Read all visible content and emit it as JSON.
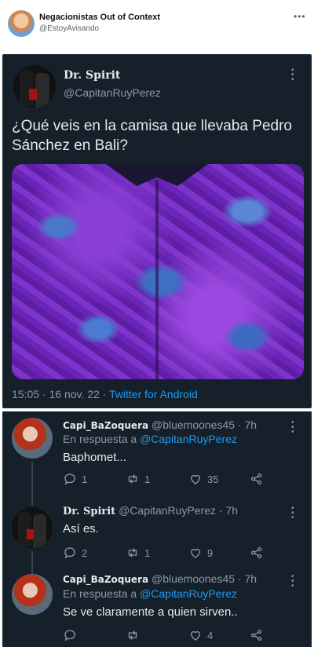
{
  "outer": {
    "name": "Negacionistas Out of Context",
    "handle": "@EstoyAvisando",
    "more_icon": "more-horizontal-icon"
  },
  "tweet": {
    "name": "Dr. Spirit",
    "handle": "@CapitanRuyPerez",
    "text": "¿Qué veis en la camisa que llevaba Pedro Sánchez en Bali?",
    "time": "15:05 · 16 nov. 22 · ",
    "source": "Twitter for Android"
  },
  "replies": [
    {
      "name": "Capi_BaZoquera",
      "handle": "@bluemoones45 · 7h",
      "reply_to_prefix": "En respuesta a ",
      "reply_to_handle": "@CapitanRuyPerez",
      "text": "Baphomet...",
      "reply_count": "1",
      "retweet_count": "1",
      "like_count": "35"
    },
    {
      "name": "Dr. Spirit",
      "handle": "@CapitanRuyPerez · 7h",
      "text": "Así es.",
      "reply_count": "2",
      "retweet_count": "1",
      "like_count": "9"
    },
    {
      "name": "Capi_BaZoquera",
      "handle": "@bluemoones45 · 7h",
      "reply_to_prefix": "En respuesta a ",
      "reply_to_handle": "@CapitanRuyPerez",
      "text": "Se ve claramente a quien sirven..",
      "reply_count": "",
      "retweet_count": "",
      "like_count": "4"
    }
  ],
  "colors": {
    "background": "#15202b",
    "text": "#e7e9ea",
    "muted": "#8b98a5",
    "link": "#1d9bf0"
  }
}
